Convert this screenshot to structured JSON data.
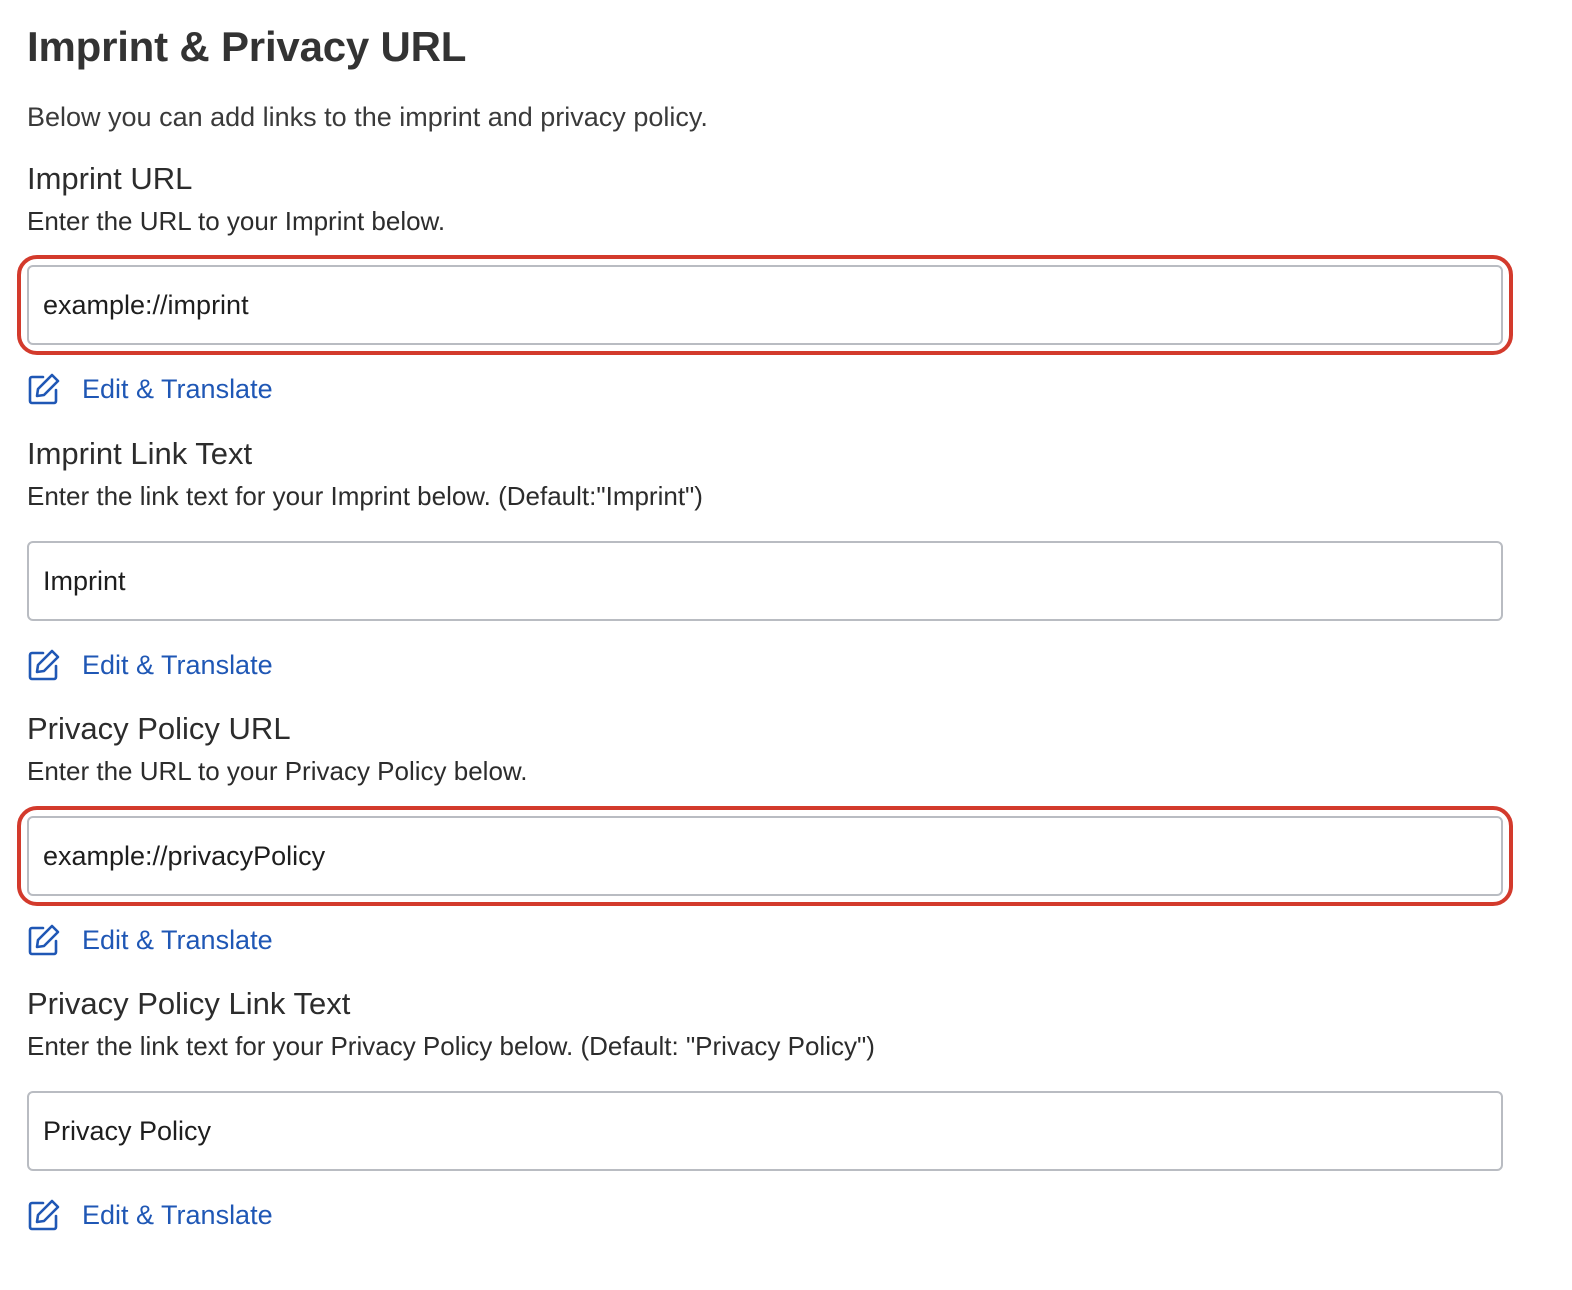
{
  "page": {
    "title": "Imprint & Privacy URL",
    "intro": "Below you can add links to the imprint and privacy policy."
  },
  "colors": {
    "link": "#1f57b5",
    "highlight": "#d33a2c",
    "input_border": "#b9bcc2"
  },
  "sections": [
    {
      "title": "Imprint URL",
      "description": "Enter the URL to your Imprint below.",
      "value": "example://imprint",
      "highlighted": true,
      "link_label": "Edit & Translate",
      "link_icon": "edit-icon"
    },
    {
      "title": "Imprint Link Text",
      "description": "Enter the link text for your Imprint below. (Default:\"Imprint\")",
      "value": "Imprint",
      "highlighted": false,
      "link_label": "Edit & Translate",
      "link_icon": "edit-icon"
    },
    {
      "title": "Privacy Policy URL",
      "description": "Enter the URL to your Privacy Policy below.",
      "value": "example://privacyPolicy",
      "highlighted": true,
      "link_label": "Edit & Translate",
      "link_icon": "edit-icon"
    },
    {
      "title": "Privacy Policy Link Text",
      "description": "Enter the link text for your Privacy Policy below. (Default: \"Privacy Policy\")",
      "value": "Privacy Policy",
      "highlighted": false,
      "link_label": "Edit & Translate",
      "link_icon": "edit-icon"
    }
  ]
}
